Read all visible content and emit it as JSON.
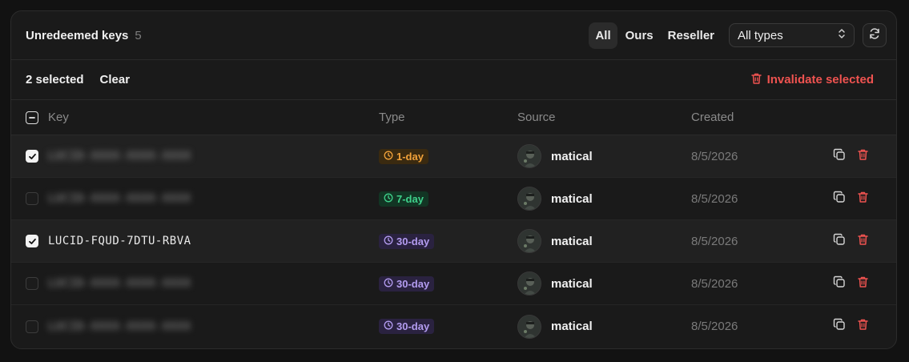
{
  "header": {
    "title": "Unredeemed keys",
    "count": "5",
    "filters": [
      {
        "label": "All",
        "active": true
      },
      {
        "label": "Ours",
        "active": false
      },
      {
        "label": "Reseller",
        "active": false
      }
    ],
    "type_select": {
      "value": "All types"
    }
  },
  "selection": {
    "count_label": "2 selected",
    "clear_label": "Clear",
    "invalidate_label": "Invalidate selected"
  },
  "columns": {
    "key": "Key",
    "type": "Type",
    "source": "Source",
    "created": "Created"
  },
  "rows": [
    {
      "key": "LUCID-XXXX-XXXX-XXXX",
      "blurred": true,
      "selected": true,
      "type": "1-day",
      "type_color": "orange",
      "source": "matical",
      "created": "8/5/2026"
    },
    {
      "key": "LUCID-XXXX-XXXX-XXXX",
      "blurred": true,
      "selected": false,
      "type": "7-day",
      "type_color": "green",
      "source": "matical",
      "created": "8/5/2026"
    },
    {
      "key": "LUCID-FQUD-7DTU-RBVA",
      "blurred": false,
      "selected": true,
      "type": "30-day",
      "type_color": "purple",
      "source": "matical",
      "created": "8/5/2026"
    },
    {
      "key": "LUCID-XXXX-XXXX-XXXX",
      "blurred": true,
      "selected": false,
      "type": "30-day",
      "type_color": "purple",
      "source": "matical",
      "created": "8/5/2026"
    },
    {
      "key": "LUCID-XXXX-XXXX-XXXX",
      "blurred": true,
      "selected": false,
      "type": "30-day",
      "type_color": "purple",
      "source": "matical",
      "created": "8/5/2026"
    }
  ],
  "colors": {
    "danger": "#ef5350",
    "orange": "#f2a23a",
    "green": "#3fd18b",
    "purple": "#b39cf0"
  }
}
